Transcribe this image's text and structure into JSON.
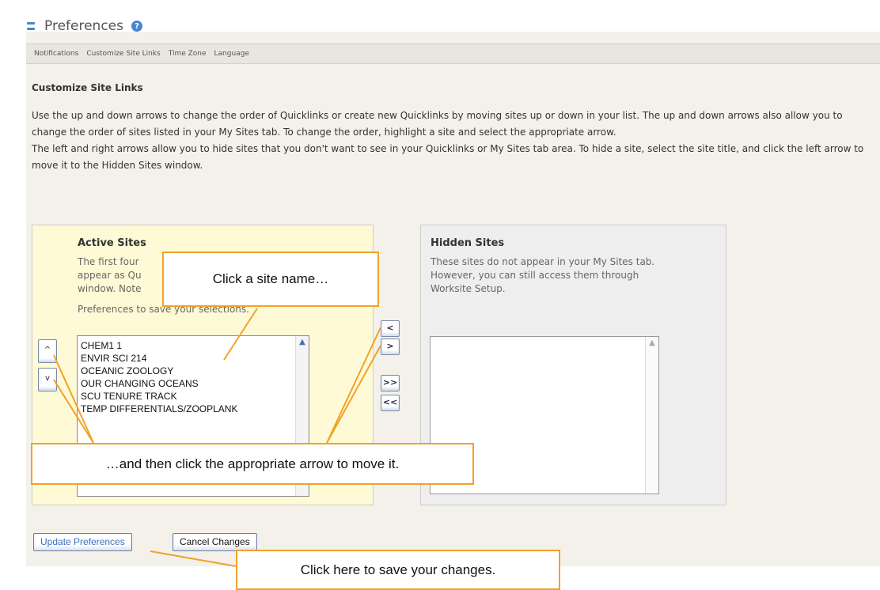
{
  "header": {
    "title": "Preferences",
    "help_icon": "?"
  },
  "nav": {
    "items": [
      "Notifications",
      "Customize Site Links",
      "Time Zone",
      "Language"
    ]
  },
  "section": {
    "title": "Customize Site Links",
    "paragraph1": "Use the up and down arrows to change the order of Quicklinks or create new Quicklinks by moving sites up or down in your list. The up and down arrows also allow you to change the order of sites listed in your My Sites tab. To change the order, highlight a site and select the appropriate arrow.",
    "paragraph2": "The left and right arrows allow you to hide sites that you don't want to see in your Quicklinks or My Sites tab area. To hide a site, select the site title, and click the left arrow to move it to the Hidden Sites window."
  },
  "active": {
    "title": "Active Sites",
    "text_lines": [
      "The first four",
      "appear as Qu",
      "window. Note",
      "Preferences to save your selections."
    ],
    "sites": [
      "CHEM1 1",
      "ENVIR SCI 214",
      "OCEANIC ZOOLOGY",
      "OUR CHANGING OCEANS",
      "SCU TENURE TRACK",
      "TEMP DIFFERENTIALS/ZOOPLANK"
    ]
  },
  "hidden": {
    "title": "Hidden Sites",
    "text": "These sites do not appear in your My Sites tab. However, you can still access them through Worksite Setup."
  },
  "arrows": {
    "up": "^",
    "down": "v",
    "left": "<",
    "right": ">",
    "all_right": ">>",
    "all_left": "<<"
  },
  "buttons": {
    "update": "Update Preferences",
    "cancel": "Cancel Changes"
  },
  "callouts": {
    "click_site": "Click a site name…",
    "click_arrow": "…and then click the appropriate arrow to move it.",
    "save": "Click here to save your changes."
  },
  "colors": {
    "callout_border": "#f2a12a",
    "active_panel": "#fffad6",
    "hidden_panel": "#eeeeee",
    "accent": "#4a84d1"
  }
}
